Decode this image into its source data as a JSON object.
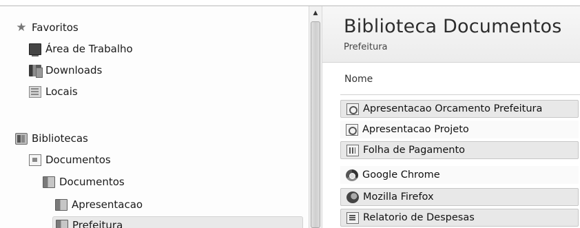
{
  "navigation": {
    "favorites": {
      "label": "Favoritos",
      "items": [
        {
          "label": "Área de Trabalho",
          "icon": "desktop-icon"
        },
        {
          "label": "Downloads",
          "icon": "downloads-folder-icon"
        },
        {
          "label": "Locais",
          "icon": "recent-places-icon"
        }
      ]
    },
    "libraries": {
      "label": "Bibliotecas",
      "items": [
        {
          "label": "Documentos",
          "icon": "documents-library-icon",
          "level": 1
        },
        {
          "label": "Documentos",
          "icon": "folder-icon",
          "level": 2
        },
        {
          "label": "Apresentacao",
          "icon": "folder-icon",
          "level": 3
        },
        {
          "label": "Prefeitura",
          "icon": "folder-icon",
          "level": 3,
          "selected": true
        }
      ]
    }
  },
  "content": {
    "title": "Biblioteca Documentos",
    "subtitle": "Prefeitura",
    "column_header": "Nome",
    "files": [
      {
        "name": "Apresentacao Orcamento Prefeitura",
        "icon": "powerpoint-file-icon"
      },
      {
        "name": "Apresentacao Projeto",
        "icon": "powerpoint-file-icon"
      },
      {
        "name": "Folha de Pagamento",
        "icon": "excel-file-icon"
      },
      {
        "name": "Google Chrome",
        "icon": "chrome-icon"
      },
      {
        "name": "Mozilla Firefox",
        "icon": "firefox-icon"
      },
      {
        "name": "Relatorio de Despesas",
        "icon": "word-file-icon"
      }
    ]
  },
  "scrollbar": {
    "up_arrow": "▲"
  }
}
